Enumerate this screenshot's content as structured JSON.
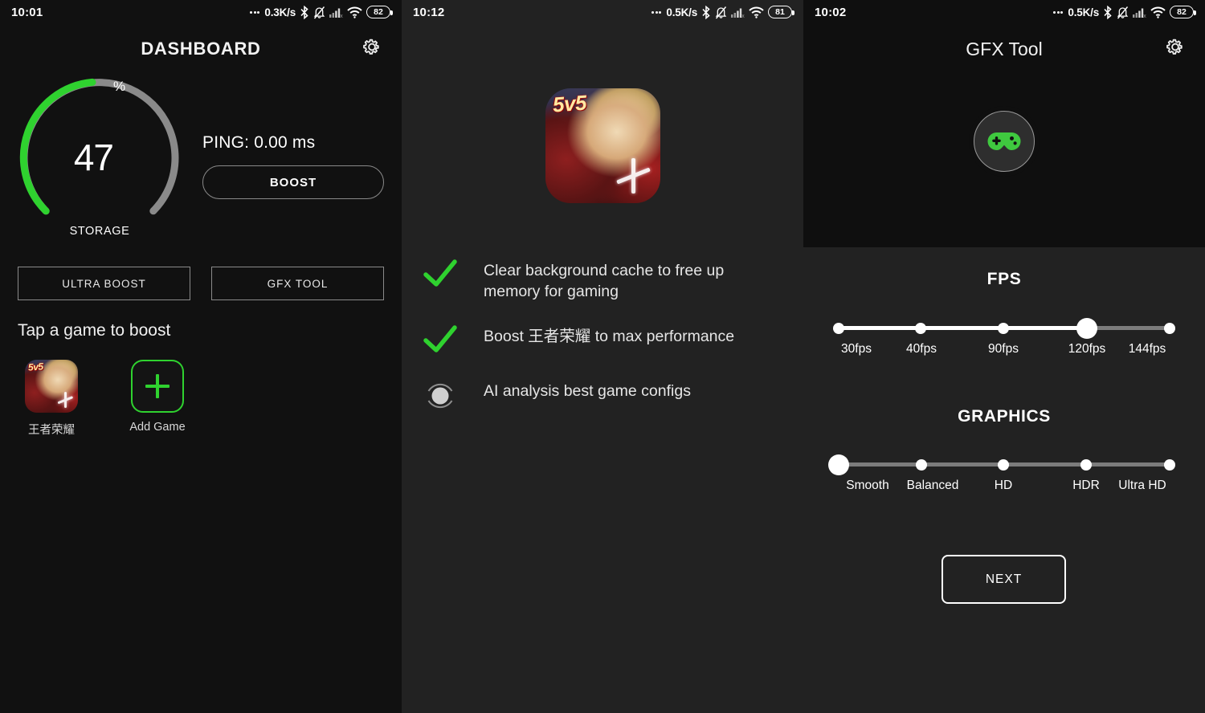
{
  "panels": {
    "dashboard": {
      "status": {
        "time": "10:01",
        "net_speed": "0.3K/s",
        "battery": "82",
        "icons": [
          "bluetooth-icon",
          "notification-muted-icon",
          "cellular-off-icon",
          "wifi-icon",
          "battery-icon"
        ]
      },
      "appbar": {
        "title": "DASHBOARD",
        "gear": "gear-icon"
      },
      "gauge": {
        "value": "47",
        "unit": "%",
        "label": "STORAGE",
        "percent": 47,
        "fill_color": "#2fd22f",
        "track_color": "#8a8a8a"
      },
      "ping": "PING: 0.00 ms",
      "boost_label": "BOOST",
      "ultra_boost_label": "ULTRA BOOST",
      "gfx_tool_label": "GFX TOOL",
      "tap_hint": "Tap a game to boost",
      "games": [
        {
          "name": "王者荣耀",
          "badge": "5v5",
          "icon": "game-app-icon"
        },
        {
          "name": "Add Game",
          "icon": "add-game-icon"
        }
      ]
    },
    "boosting": {
      "status": {
        "time": "10:12",
        "net_speed": "0.5K/s",
        "battery": "81"
      },
      "hero_badge": "5v5",
      "steps": [
        {
          "state": "done",
          "icon": "check-icon",
          "text": "Clear background cache to free up memory for gaming"
        },
        {
          "state": "done",
          "icon": "check-icon",
          "text": "Boost 王者荣耀 to max performance"
        },
        {
          "state": "loading",
          "icon": "spinner-icon",
          "text": "AI analysis best game configs"
        }
      ]
    },
    "gfx": {
      "status": {
        "time": "10:02",
        "net_speed": "0.5K/s",
        "battery": "82"
      },
      "appbar": {
        "title": "GFX Tool",
        "gear": "gear-icon"
      },
      "hero_icon": "gamepad-icon",
      "fps": {
        "title": "FPS",
        "options": [
          "30fps",
          "40fps",
          "90fps",
          "120fps",
          "144fps"
        ],
        "selected_index": 3
      },
      "graphics": {
        "title": "GRAPHICS",
        "options": [
          "Smooth",
          "Balanced",
          "HD",
          "HDR",
          "Ultra HD"
        ],
        "selected_index": 0
      },
      "next_label": "NEXT"
    }
  },
  "colors": {
    "accent_green": "#2fd22f",
    "bg_dark": "#111111",
    "bg_panel": "#222222",
    "text": "#ffffff"
  }
}
